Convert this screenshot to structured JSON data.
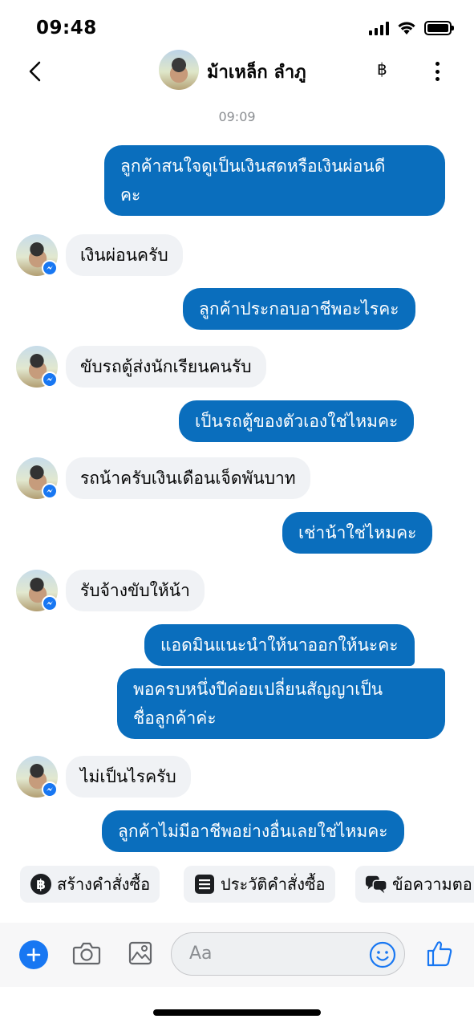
{
  "status_bar": {
    "time": "09:48"
  },
  "header": {
    "contact_name": "ม้าเหล็ก ลำภู",
    "baht_symbol": "฿"
  },
  "conversation": {
    "timestamp": "09:09",
    "messages": [
      {
        "from": "me",
        "lines": [
          "ลูกค้าสนใจดูเป็นเงินสดหรือเงินผ่อนดี",
          "คะ"
        ]
      },
      {
        "from": "them",
        "lines": [
          "เงินผ่อนครับ"
        ]
      },
      {
        "from": "me",
        "lines": [
          "ลูกค้าประกอบอาชีพอะไรคะ"
        ]
      },
      {
        "from": "them",
        "lines": [
          "ขับรถตู้ส่งนักเรียนคนรับ"
        ]
      },
      {
        "from": "me",
        "lines": [
          "เป็นรถตู้ของตัวเองใช่ไหมคะ"
        ]
      },
      {
        "from": "them",
        "lines": [
          "รถน้าครับเงินเดือนเจ็ดพันบาท"
        ]
      },
      {
        "from": "me",
        "lines": [
          "เช่าน้าใช่ไหมคะ"
        ]
      },
      {
        "from": "them",
        "lines": [
          "รับจ้างขับให้น้า"
        ]
      },
      {
        "from": "me",
        "lines": [
          "แอดมินแนะนำให้นาออกให้นะคะ"
        ]
      },
      {
        "from": "me",
        "lines": [
          "พอครบหนึ่งปีค่อยเปลี่ยนสัญญาเป็น",
          "ชื่อลูกค้าค่ะ"
        ]
      },
      {
        "from": "them",
        "lines": [
          "ไม่เป็นไรครับ"
        ]
      },
      {
        "from": "me",
        "lines": [
          "ลูกค้าไม่มีอาชีพอย่างอื่นเลยใช่ไหมคะ"
        ]
      }
    ]
  },
  "quick_replies": [
    {
      "label": "สร้างคำสั่งซื้อ",
      "icon": "baht-circle-icon"
    },
    {
      "label": "ประวัติคำสั่งซื้อ",
      "icon": "list-icon"
    },
    {
      "label": "ข้อความตอ",
      "icon": "chat-bubbles-icon"
    }
  ],
  "composer": {
    "placeholder": "Aa"
  },
  "colors": {
    "outgoing_bubble": "#0a6ebd",
    "incoming_bubble": "#f0f2f5",
    "messenger_blue": "#1877f2"
  }
}
